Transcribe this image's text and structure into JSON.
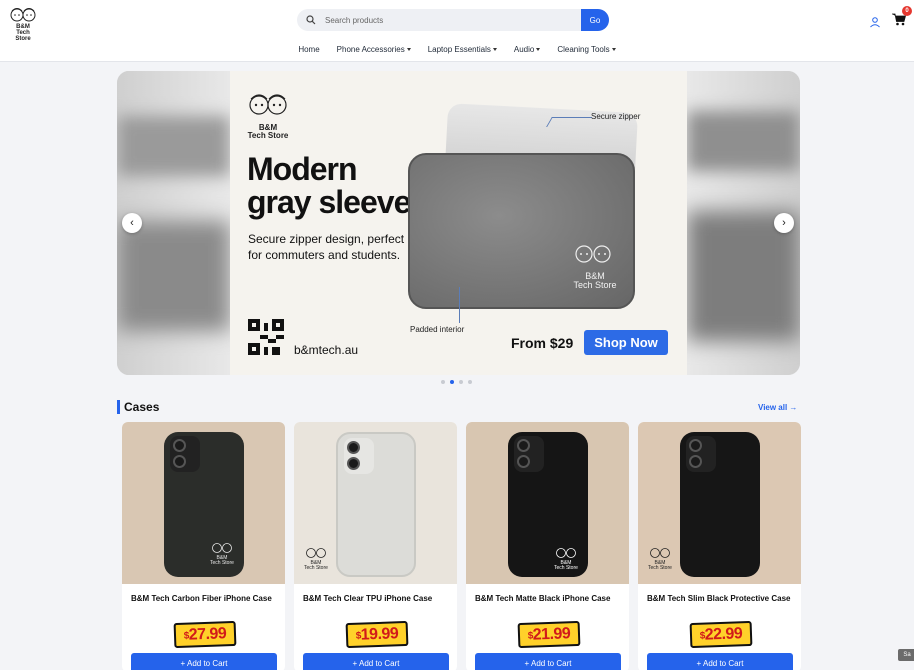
{
  "header": {
    "logo_line1": "B&M",
    "logo_line2": "Tech Store",
    "search_placeholder": "Search products",
    "search_button": "Go",
    "cart_count": "0",
    "nav": [
      {
        "label": "Home",
        "dropdown": false
      },
      {
        "label": "Phone Accessories",
        "dropdown": true
      },
      {
        "label": "Laptop Essentials",
        "dropdown": true
      },
      {
        "label": "Audio",
        "dropdown": true
      },
      {
        "label": "Cleaning Tools",
        "dropdown": true
      }
    ],
    "icons": [
      "search-icon",
      "user-icon",
      "cart-icon"
    ]
  },
  "hero": {
    "logo_line1": "B&M",
    "logo_line2": "Tech Store",
    "headline_1": "Modern",
    "headline_2": "gray sleeve",
    "subline": "Secure zipper design, perfect for commuters and students.",
    "website": "b&mtech.au",
    "callout_zipper": "Secure zipper",
    "callout_padded": "Padded interior",
    "price": "From $29",
    "cta": "Shop Now",
    "prev_arrow": "‹",
    "next_arrow": "›",
    "active_slide": 2,
    "slide_count": 4
  },
  "section": {
    "title": "Cases",
    "view_all": "View all →",
    "add_label": "+ Add to Cart",
    "products": [
      {
        "name": "B&M Tech Carbon Fiber iPhone Case",
        "price": "27.99",
        "currency": "$",
        "bg": "#d9c7b3",
        "case": "#2b2d2a",
        "logo_color": "#e8e8e8"
      },
      {
        "name": "B&M Tech Clear TPU iPhone Case",
        "price": "19.99",
        "currency": "$",
        "bg": "#e9e4dc",
        "case": "#dcdcd8",
        "logo_color": "#222222"
      },
      {
        "name": "B&M Tech Matte Black iPhone Case",
        "price": "21.99",
        "currency": "$",
        "bg": "#d8c6b1",
        "case": "#151515",
        "logo_color": "#ffffff"
      },
      {
        "name": "B&M Tech Slim Black Protective Case",
        "price": "22.99",
        "currency": "$",
        "bg": "#dcc8b3",
        "case": "#161616",
        "logo_color": "#222222"
      }
    ]
  },
  "tooltip": "Sa",
  "colors": {
    "accent": "#2563eb",
    "price_tag": "#ffd12a",
    "price_text": "#d11a1a",
    "badge": "#e5372f"
  }
}
